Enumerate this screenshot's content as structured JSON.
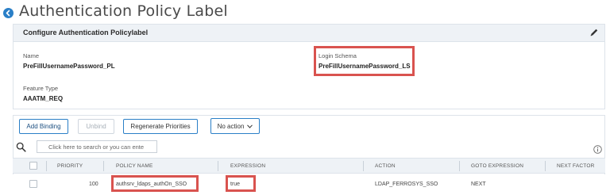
{
  "page": {
    "title": "Authentication Policy Label"
  },
  "config": {
    "header": "Configure Authentication Policylabel",
    "name_label": "Name",
    "name_value": "PreFillUsernamePassword_PL",
    "login_schema_label": "Login Schema",
    "login_schema_value": "PreFillUsernamePassword_LS",
    "feature_type_label": "Feature Type",
    "feature_type_value": "AAATM_REQ"
  },
  "toolbar": {
    "add_binding": "Add Binding",
    "unbind": "Unbind",
    "regenerate": "Regenerate Priorities",
    "action_select": "No action"
  },
  "search": {
    "placeholder": "Click here to search or you can ente"
  },
  "table": {
    "columns": [
      "PRIORITY",
      "POLICY NAME",
      "EXPRESSION",
      "ACTION",
      "GOTO EXPRESSION",
      "NEXT FACTOR"
    ],
    "rows": [
      {
        "priority": "100",
        "policy_name": "authsrv_ldaps_authOn_SSO",
        "expression": "true",
        "action": "LDAP_FERROSYS_SSO",
        "goto_expression": "NEXT",
        "next_factor": ""
      }
    ]
  },
  "colors": {
    "accent": "#2a7fc7",
    "highlight": "#d9534f",
    "header_bg": "#eef2f6"
  }
}
